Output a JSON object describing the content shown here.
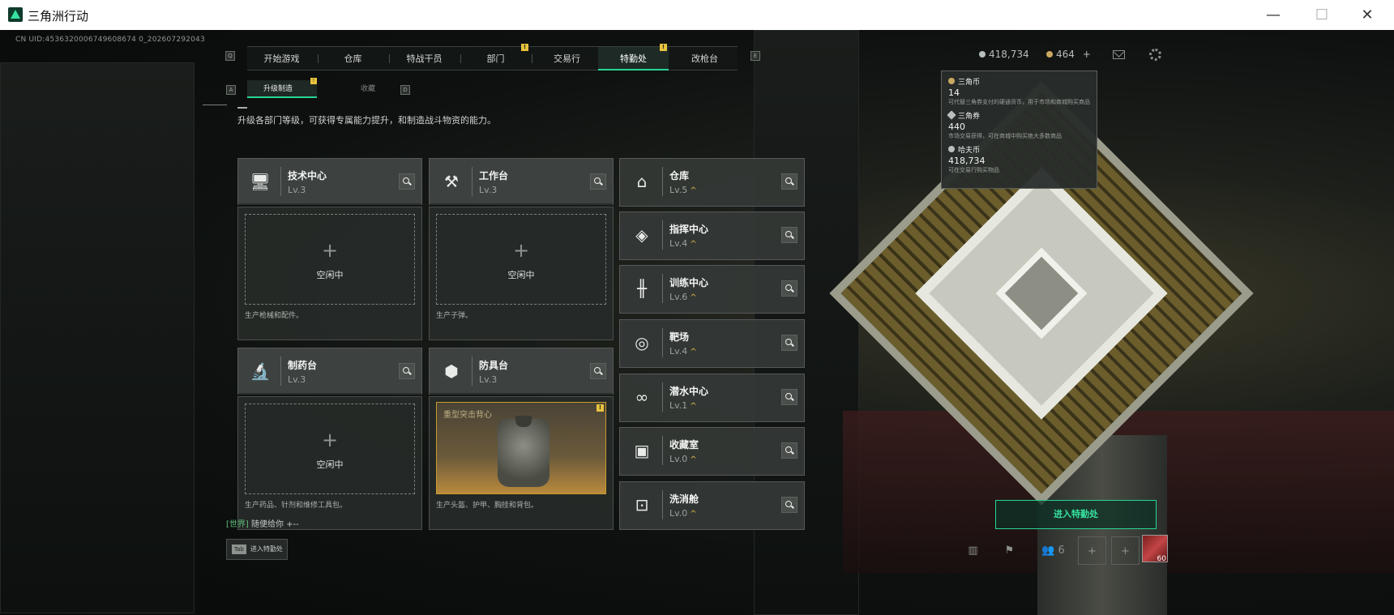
{
  "window": {
    "title": "三角洲行动"
  },
  "uid": "CN UID:4536320006749608674 0_202607292043",
  "main_tabs": [
    {
      "key": "Q",
      "label": "开始游戏"
    },
    {
      "label": "仓库"
    },
    {
      "label": "特战干员"
    },
    {
      "label": "部门",
      "alert": "!"
    },
    {
      "label": "交易行"
    },
    {
      "label": "特勤处",
      "alert": "!",
      "active": true
    },
    {
      "label": "改枪台"
    },
    {
      "key": "E"
    }
  ],
  "sub_tabs": {
    "left_key": "A",
    "items": [
      {
        "label": "升级制造",
        "alert": "!",
        "active": true
      },
      {
        "label": "收藏"
      }
    ],
    "right_key": "D"
  },
  "description": "升级各部门等级，可获得专属能力提升，和制造战斗物资的能力。",
  "currency": {
    "hafu_coin": "418,734",
    "triangle_coin": "464",
    "add": "+"
  },
  "tooltip": [
    {
      "name": "三角币",
      "value": "14",
      "desc": "可代替三角券支付的硬通货币，用于市场和商城购买商品"
    },
    {
      "name": "三角券",
      "value": "440",
      "desc": "市场交易获得，可在商城中购买绝大多数商品"
    },
    {
      "name": "哈夫币",
      "value": "418,734",
      "desc": "可在交易行购买物品"
    }
  ],
  "production_facilities": [
    {
      "name": "技术中心",
      "level": "Lv.3",
      "icon": "computer-icon",
      "slot": {
        "state": "空闲中",
        "plus": "+"
      },
      "desc": "生产枪械和配件。"
    },
    {
      "name": "工作台",
      "level": "Lv.3",
      "icon": "tools-icon",
      "slot": {
        "state": "空闲中",
        "plus": "+"
      },
      "desc": "生产子弹。"
    },
    {
      "name": "制药台",
      "level": "Lv.3",
      "icon": "microscope-icon",
      "slot": {
        "state": "空闲中",
        "plus": "+"
      },
      "desc": "生产药品、针剂和维修工具包。"
    },
    {
      "name": "防具台",
      "level": "Lv.3",
      "icon": "cubes-icon",
      "slot": {
        "item": "重型突击背心",
        "alert": "!"
      },
      "desc": "生产头盔、护甲、胸挂和背包。"
    }
  ],
  "other_facilities": [
    {
      "name": "仓库",
      "level": "Lv.5",
      "icon": "warehouse-icon",
      "up": "^"
    },
    {
      "name": "指挥中心",
      "level": "Lv.4",
      "icon": "command-icon",
      "up": "^"
    },
    {
      "name": "训练中心",
      "level": "Lv.6",
      "icon": "dumbbell-icon",
      "up": "^"
    },
    {
      "name": "靶场",
      "level": "Lv.4",
      "icon": "target-icon",
      "up": "^"
    },
    {
      "name": "潜水中心",
      "level": "Lv.1",
      "icon": "goggles-icon",
      "up": "^"
    },
    {
      "name": "收藏室",
      "level": "Lv.0",
      "icon": "safe-icon",
      "up": "^"
    },
    {
      "name": "洗消舱",
      "level": "Lv.0",
      "icon": "decon-icon",
      "up": "^"
    }
  ],
  "enter_button": "进入特勤处",
  "chat": {
    "channel": "[世界]",
    "message": "随便给你 +--"
  },
  "tab_hint": {
    "key": "Tab",
    "label": "进入特勤处"
  },
  "bottom_bar": {
    "friends": "6",
    "player_level": "60",
    "plus": "+"
  }
}
